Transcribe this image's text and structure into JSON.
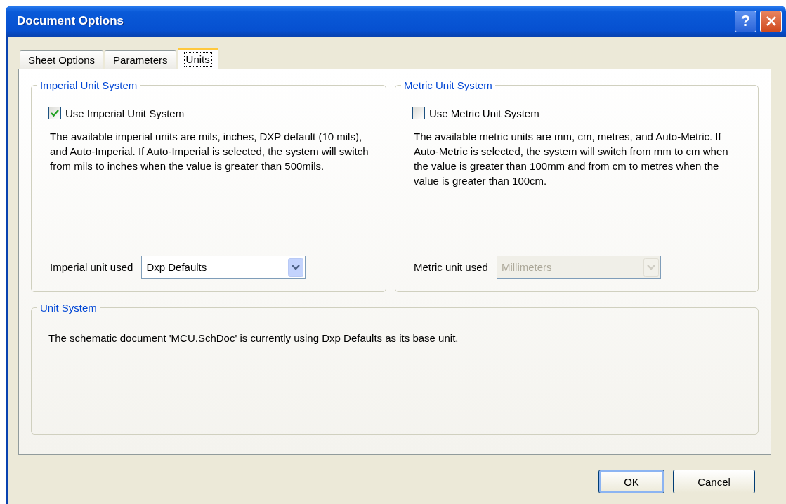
{
  "window": {
    "title": "Document Options",
    "help": "?"
  },
  "tabs": [
    {
      "label": "Sheet Options",
      "selected": false
    },
    {
      "label": "Parameters",
      "selected": false
    },
    {
      "label": "Units",
      "selected": true
    }
  ],
  "groups": [
    {
      "title": "Imperial Unit System",
      "checkbox": {
        "label": "Use Imperial Unit System",
        "checked": true
      },
      "description": "The available imperial units are mils, inches, DXP default (10 mils), and Auto-Imperial. If Auto-Imperial is selected, the system will switch from mils to inches when the value is greater than 500mils.",
      "unit_label": "Imperial unit used",
      "select": {
        "value": "Dxp Defaults",
        "disabled": false
      }
    },
    {
      "title": "Metric Unit System",
      "checkbox": {
        "label": "Use Metric Unit System",
        "checked": false
      },
      "description": "The available metric units are mm, cm,  metres, and Auto-Metric. If Auto-Metric is selected, the system will switch from mm to cm when the value is greater than 100mm and from cm to metres when the value is greater than 100cm.",
      "unit_label": "Metric unit used",
      "select": {
        "value": "Millimeters",
        "disabled": true
      }
    }
  ],
  "unit_system": {
    "title": "Unit  System",
    "text": "The schematic document 'MCU.SchDoc' is currently using Dxp Defaults as its base unit."
  },
  "buttons": [
    {
      "label": "OK",
      "default": true
    },
    {
      "label": "Cancel",
      "default": false
    }
  ]
}
